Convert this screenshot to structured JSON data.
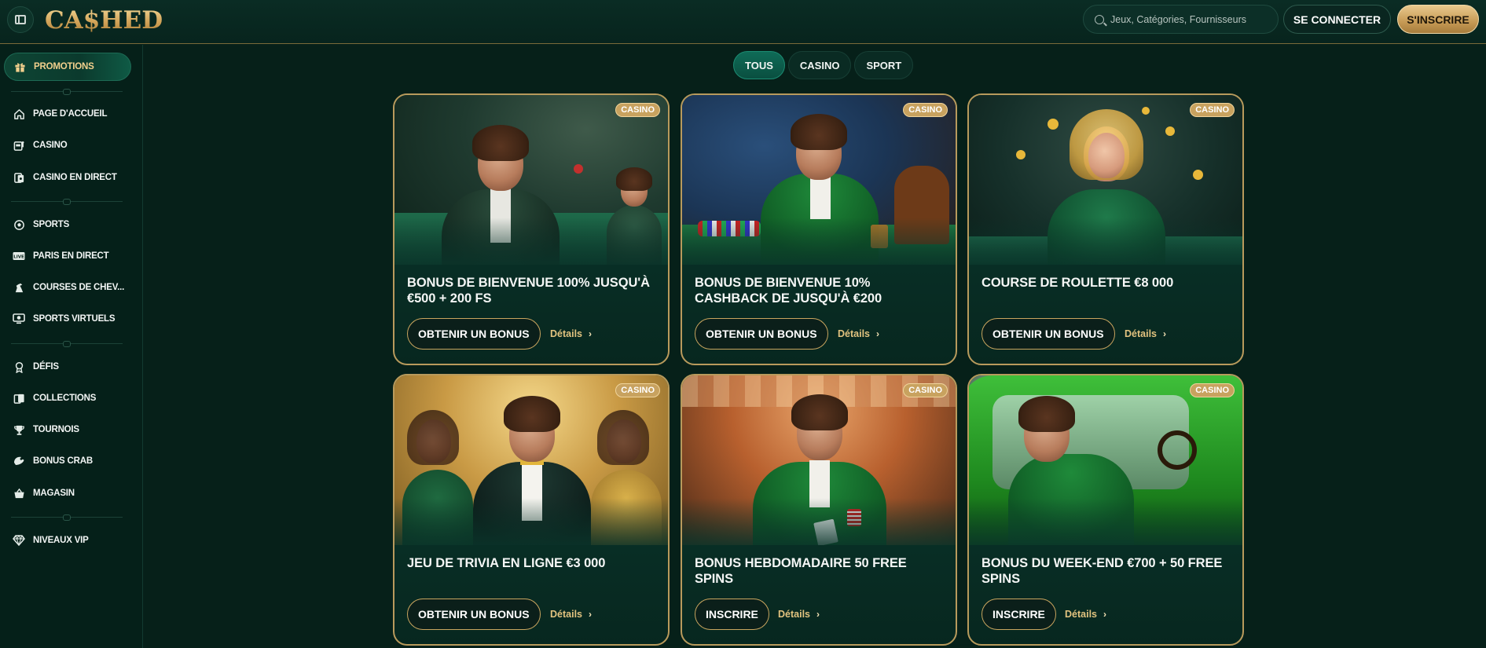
{
  "header": {
    "logo_text": "CA$HED",
    "search_placeholder": "Jeux, Catégories, Fournisseurs",
    "login_label": "SE CONNECTER",
    "signup_label": "S'INSCRIRE"
  },
  "sidebar": {
    "promo": {
      "label": "PROMOTIONS",
      "icon": "gift-icon"
    },
    "items": [
      {
        "label": "PAGE D'ACCUEIL",
        "icon": "home-icon"
      },
      {
        "label": "CASINO",
        "icon": "slot-machine-icon"
      },
      {
        "label": "CASINO EN DIRECT",
        "icon": "live-casino-icon"
      },
      {
        "label": "SPORTS",
        "icon": "soccer-ball-icon"
      },
      {
        "label": "PARIS EN DIRECT",
        "icon": "live-badge-icon"
      },
      {
        "label": "COURSES DE CHEV...",
        "icon": "horse-icon"
      },
      {
        "label": "SPORTS VIRTUELS",
        "icon": "virtual-sports-icon"
      },
      {
        "label": "DÉFIS",
        "icon": "medal-icon"
      },
      {
        "label": "COLLECTIONS",
        "icon": "cards-icon"
      },
      {
        "label": "TOURNOIS",
        "icon": "trophy-icon"
      },
      {
        "label": "BONUS CRAB",
        "icon": "crab-claw-icon"
      },
      {
        "label": "MAGASIN",
        "icon": "basket-icon"
      },
      {
        "label": "NIVEAUX VIP",
        "icon": "diamond-icon"
      }
    ]
  },
  "tabs": [
    {
      "label": "TOUS",
      "active": true
    },
    {
      "label": "CASINO",
      "active": false
    },
    {
      "label": "SPORT",
      "active": false
    }
  ],
  "cards": [
    {
      "badge": "CASINO",
      "title": "BONUS DE BIENVENUE 100% JUSQU'À €500 + 200 FS",
      "button": "OBTENIR UN BONUS",
      "details": "Détails"
    },
    {
      "badge": "CASINO",
      "title": "BONUS DE BIENVENUE 10% CASHBACK DE JUSQU'À €200",
      "button": "OBTENIR UN BONUS",
      "details": "Détails"
    },
    {
      "badge": "CASINO",
      "title": "COURSE DE ROULETTE €8 000",
      "button": "OBTENIR UN BONUS",
      "details": "Détails"
    },
    {
      "badge": "CASINO",
      "title": "JEU DE TRIVIA EN LIGNE €3 000",
      "button": "OBTENIR UN BONUS",
      "details": "Détails"
    },
    {
      "badge": "CASINO",
      "title": "BONUS HEBDOMADAIRE 50 FREE SPINS",
      "button": "INSCRIRE",
      "details": "Détails"
    },
    {
      "badge": "CASINO",
      "title": "BONUS DU WEEK-END €700 + 50 FREE SPINS",
      "button": "INSCRIRE",
      "details": "Détails"
    }
  ]
}
